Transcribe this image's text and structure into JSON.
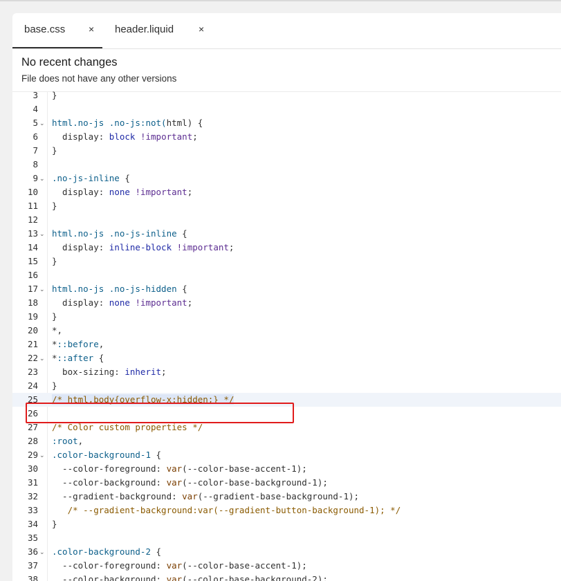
{
  "tabs": [
    {
      "label": "base.css",
      "close": "×",
      "active": true
    },
    {
      "label": "header.liquid",
      "close": "×",
      "active": false
    }
  ],
  "info": {
    "title": "No recent changes",
    "subtitle": "File does not have any other versions"
  },
  "editor": {
    "first_line_offset": 0,
    "active_line": 25,
    "lines": [
      {
        "n": "3",
        "fold": "",
        "tokens": [
          {
            "t": "}",
            "c": ""
          }
        ]
      },
      {
        "n": "4",
        "fold": "",
        "tokens": []
      },
      {
        "n": "5",
        "fold": "⌄",
        "tokens": [
          {
            "t": "html.no-js .no-js:not(",
            "c": "sel"
          },
          {
            "t": "html",
            "c": ""
          },
          {
            "t": ") {",
            "c": ""
          }
        ]
      },
      {
        "n": "6",
        "fold": "",
        "tokens": [
          {
            "t": "  display: ",
            "c": ""
          },
          {
            "t": "block",
            "c": "val"
          },
          {
            "t": " ",
            "c": ""
          },
          {
            "t": "!important",
            "c": "imp"
          },
          {
            "t": ";",
            "c": ""
          }
        ]
      },
      {
        "n": "7",
        "fold": "",
        "tokens": [
          {
            "t": "}",
            "c": ""
          }
        ]
      },
      {
        "n": "8",
        "fold": "",
        "tokens": []
      },
      {
        "n": "9",
        "fold": "⌄",
        "tokens": [
          {
            "t": ".no-js-inline",
            "c": "sel"
          },
          {
            "t": " {",
            "c": ""
          }
        ]
      },
      {
        "n": "10",
        "fold": "",
        "tokens": [
          {
            "t": "  display: ",
            "c": ""
          },
          {
            "t": "none",
            "c": "val"
          },
          {
            "t": " ",
            "c": ""
          },
          {
            "t": "!important",
            "c": "imp"
          },
          {
            "t": ";",
            "c": ""
          }
        ]
      },
      {
        "n": "11",
        "fold": "",
        "tokens": [
          {
            "t": "}",
            "c": ""
          }
        ]
      },
      {
        "n": "12",
        "fold": "",
        "tokens": []
      },
      {
        "n": "13",
        "fold": "⌄",
        "tokens": [
          {
            "t": "html.no-js .no-js-inline",
            "c": "sel"
          },
          {
            "t": " {",
            "c": ""
          }
        ]
      },
      {
        "n": "14",
        "fold": "",
        "tokens": [
          {
            "t": "  display: ",
            "c": ""
          },
          {
            "t": "inline-block",
            "c": "val"
          },
          {
            "t": " ",
            "c": ""
          },
          {
            "t": "!important",
            "c": "imp"
          },
          {
            "t": ";",
            "c": ""
          }
        ]
      },
      {
        "n": "15",
        "fold": "",
        "tokens": [
          {
            "t": "}",
            "c": ""
          }
        ]
      },
      {
        "n": "16",
        "fold": "",
        "tokens": []
      },
      {
        "n": "17",
        "fold": "⌄",
        "tokens": [
          {
            "t": "html.no-js .no-js-hidden",
            "c": "sel"
          },
          {
            "t": " {",
            "c": ""
          }
        ]
      },
      {
        "n": "18",
        "fold": "",
        "tokens": [
          {
            "t": "  display: ",
            "c": ""
          },
          {
            "t": "none",
            "c": "val"
          },
          {
            "t": " ",
            "c": ""
          },
          {
            "t": "!important",
            "c": "imp"
          },
          {
            "t": ";",
            "c": ""
          }
        ]
      },
      {
        "n": "19",
        "fold": "",
        "tokens": [
          {
            "t": "}",
            "c": ""
          }
        ]
      },
      {
        "n": "20",
        "fold": "",
        "tokens": [
          {
            "t": "*,",
            "c": ""
          }
        ]
      },
      {
        "n": "21",
        "fold": "",
        "tokens": [
          {
            "t": "*",
            "c": ""
          },
          {
            "t": "::before",
            "c": "sel"
          },
          {
            "t": ",",
            "c": ""
          }
        ]
      },
      {
        "n": "22",
        "fold": "⌄",
        "tokens": [
          {
            "t": "*",
            "c": ""
          },
          {
            "t": "::after",
            "c": "sel"
          },
          {
            "t": " {",
            "c": ""
          }
        ]
      },
      {
        "n": "23",
        "fold": "",
        "tokens": [
          {
            "t": "  box-sizing: ",
            "c": ""
          },
          {
            "t": "inherit",
            "c": "val"
          },
          {
            "t": ";",
            "c": ""
          }
        ]
      },
      {
        "n": "24",
        "fold": "",
        "tokens": [
          {
            "t": "}",
            "c": ""
          }
        ]
      },
      {
        "n": "25",
        "fold": "",
        "tokens": [
          {
            "t": "/* html,body{overflow-x:hidden;} */",
            "c": "cmsel"
          }
        ]
      },
      {
        "n": "26",
        "fold": "",
        "tokens": []
      },
      {
        "n": "27",
        "fold": "",
        "tokens": [
          {
            "t": "/* Color custom properties */",
            "c": "cm"
          }
        ]
      },
      {
        "n": "28",
        "fold": "",
        "tokens": [
          {
            "t": ":root",
            "c": "sel"
          },
          {
            "t": ",",
            "c": ""
          }
        ]
      },
      {
        "n": "29",
        "fold": "⌄",
        "tokens": [
          {
            "t": ".color-background-1",
            "c": "sel"
          },
          {
            "t": " {",
            "c": ""
          }
        ]
      },
      {
        "n": "30",
        "fold": "",
        "tokens": [
          {
            "t": "  --color-foreground: ",
            "c": ""
          },
          {
            "t": "var",
            "c": "fn"
          },
          {
            "t": "(--color-base-accent-1);",
            "c": ""
          }
        ]
      },
      {
        "n": "31",
        "fold": "",
        "tokens": [
          {
            "t": "  --color-background: ",
            "c": ""
          },
          {
            "t": "var",
            "c": "fn"
          },
          {
            "t": "(--color-base-background-1);",
            "c": ""
          }
        ]
      },
      {
        "n": "32",
        "fold": "",
        "tokens": [
          {
            "t": "  --gradient-background: ",
            "c": ""
          },
          {
            "t": "var",
            "c": "fn"
          },
          {
            "t": "(--gradient-base-background-1);",
            "c": ""
          }
        ]
      },
      {
        "n": "33",
        "fold": "",
        "tokens": [
          {
            "t": "   /* --gradient-background:var(--gradient-button-background-1); */",
            "c": "cm"
          }
        ]
      },
      {
        "n": "34",
        "fold": "",
        "tokens": [
          {
            "t": "}",
            "c": ""
          }
        ]
      },
      {
        "n": "35",
        "fold": "",
        "tokens": []
      },
      {
        "n": "36",
        "fold": "⌄",
        "tokens": [
          {
            "t": ".color-background-2",
            "c": "sel"
          },
          {
            "t": " {",
            "c": ""
          }
        ]
      },
      {
        "n": "37",
        "fold": "",
        "tokens": [
          {
            "t": "  --color-foreground: ",
            "c": ""
          },
          {
            "t": "var",
            "c": "fn"
          },
          {
            "t": "(--color-base-accent-1);",
            "c": ""
          }
        ]
      },
      {
        "n": "38",
        "fold": "",
        "tokens": [
          {
            "t": "  --color-background: ",
            "c": ""
          },
          {
            "t": "var",
            "c": "fn"
          },
          {
            "t": "(--color-base-background-2);",
            "c": ""
          }
        ]
      }
    ]
  },
  "colors": {
    "selector": "#0c5f8a",
    "keyword": "#5c2d91",
    "value": "#1f2aa6",
    "function": "#7a3e00",
    "comment": "#8a5a00",
    "highlight_border": "#e01b1b"
  }
}
